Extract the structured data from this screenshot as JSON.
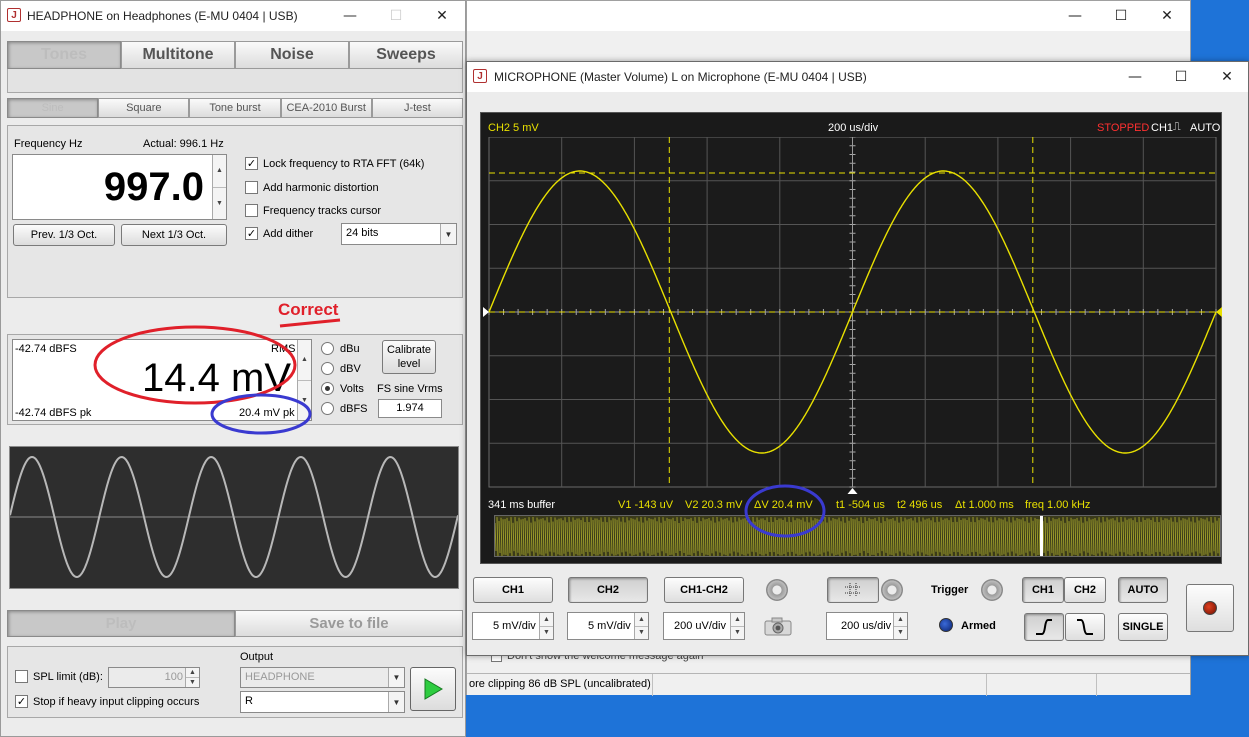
{
  "colors": {
    "scope_trace": "#e8e000",
    "annotation_red": "#e0202a",
    "annotation_blue": "#3a3ad0",
    "stopped": "#ff3030",
    "desktop": "#1e73d8"
  },
  "bg_window": {
    "checkbox_label": "Don't show the welcome message again",
    "status_left": "ore clipping 86 dB SPL (uncalibrated)"
  },
  "headphone_window": {
    "title": "HEADPHONE on Headphones (E-MU 0404 | USB)",
    "main_tabs": [
      "Tones",
      "Multitone",
      "Noise",
      "Sweeps"
    ],
    "sub_tabs": [
      "Sine",
      "Square",
      "Tone burst",
      "CEA-2010 Burst",
      "J-test"
    ],
    "frequency": {
      "label": "Frequency Hz",
      "actual": "Actual: 996.1 Hz",
      "value": "997.0",
      "prev_button": "Prev. 1/3 Oct.",
      "next_button": "Next 1/3 Oct."
    },
    "options": {
      "lock_rta": "Lock frequency to RTA FFT (64k)",
      "harmonic": "Add harmonic distortion",
      "tracks_cursor": "Frequency tracks cursor",
      "add_dither": "Add dither",
      "dither_bits": "24 bits"
    },
    "level": {
      "dbfs_top": "-42.74 dBFS",
      "rms_label": "RMS",
      "value": "14.4 mV",
      "dbfs_pk": "-42.74 dBFS pk",
      "mv_pk": "20.4 mV pk",
      "units": [
        "dBu",
        "dBV",
        "Volts",
        "dBFS"
      ],
      "calibrate_line1": "Calibrate",
      "calibrate_line2": "level",
      "fs_label": "FS sine Vrms",
      "fs_value": "1.974"
    },
    "annotation_correct": "Correct",
    "play": "Play",
    "save_to_file": "Save to file",
    "spl_limit": "SPL limit (dB):",
    "spl_value": "100",
    "output_label": "Output",
    "output_device": "HEADPHONE",
    "output_channel": "R",
    "stop_clipping": "Stop if heavy input clipping occurs"
  },
  "mic_window": {
    "title": "MICROPHONE (Master Volume) L on Microphone (E-MU 0404 | USB)",
    "scope": {
      "ch_scale": "CH2 5 mV",
      "timebase": "200 us/div",
      "stopped": "STOPPED",
      "trigger_info": "CH1",
      "trigger_mode": "AUTO",
      "buffer": "341 ms buffer",
      "v1": "V1 -143 uV",
      "v2": "V2 20.3 mV",
      "dv": "ΔV 20.4 mV",
      "t1": "t1 -504 us",
      "t2": "t2 496 us",
      "dt": "Δt 1.000 ms",
      "freq": "freq 1.00 kHz"
    },
    "controls": {
      "ch1": "CH1",
      "ch2": "CH2",
      "ch1_ch2": "CH1-CH2",
      "ch1_div": "5 mV/div",
      "ch2_div": "5 mV/div",
      "diff_div": "200 uV/div",
      "time_div": "200 us/div",
      "trigger": "Trigger",
      "armed": "Armed",
      "trig_ch1": "CH1",
      "trig_ch2": "CH2",
      "auto": "AUTO",
      "single": "SINGLE"
    }
  }
}
